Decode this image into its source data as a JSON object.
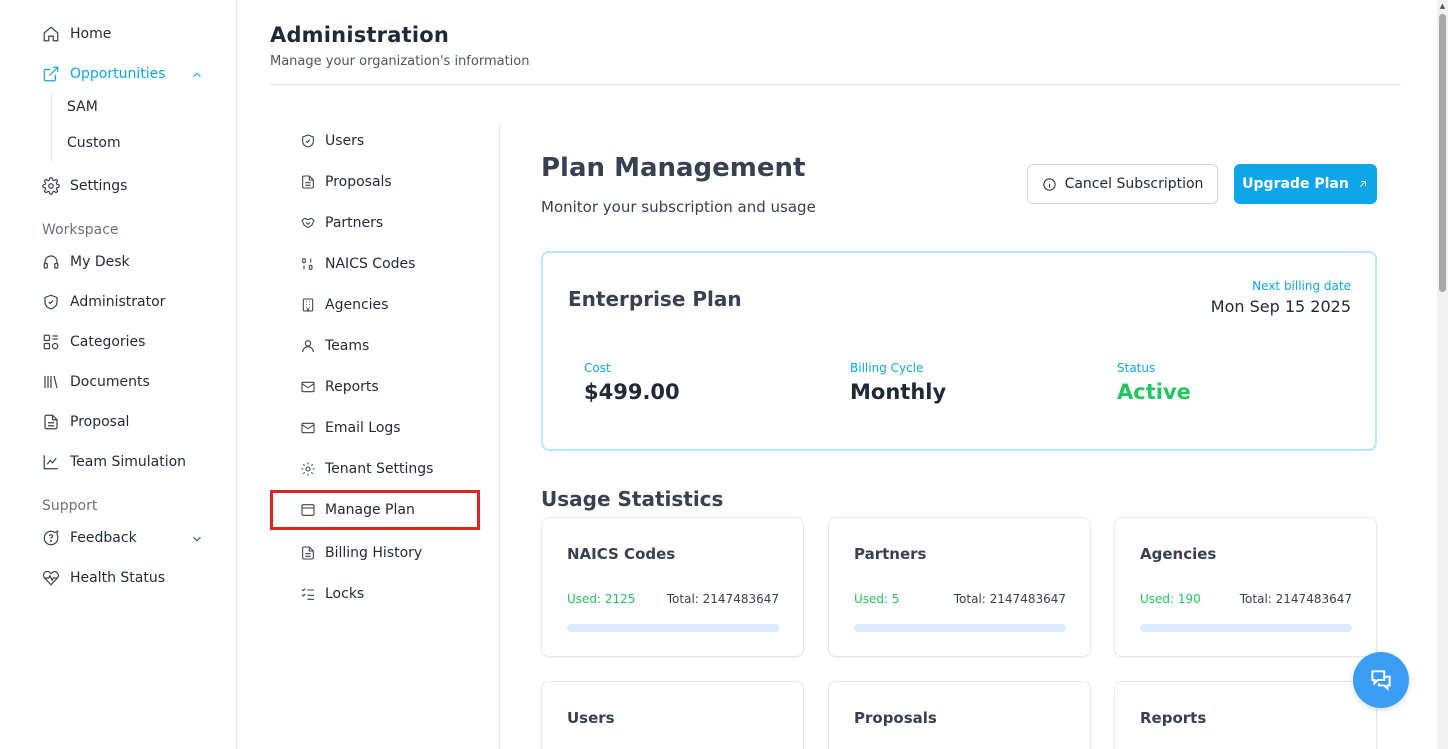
{
  "sidebar": {
    "home": "Home",
    "opportunities": "Opportunities",
    "sam": "SAM",
    "custom": "Custom",
    "settings": "Settings",
    "workspace_label": "Workspace",
    "my_desk": "My Desk",
    "administrator": "Administrator",
    "categories": "Categories",
    "documents": "Documents",
    "proposal": "Proposal",
    "team_simulation": "Team Simulation",
    "support_label": "Support",
    "feedback": "Feedback",
    "health_status": "Health Status"
  },
  "header": {
    "title": "Administration",
    "subtitle": "Manage your organization's information"
  },
  "admin_menu": {
    "users": "Users",
    "proposals": "Proposals",
    "partners": "Partners",
    "naics_codes": "NAICS Codes",
    "agencies": "Agencies",
    "teams": "Teams",
    "reports": "Reports",
    "email_logs": "Email Logs",
    "tenant_settings": "Tenant Settings",
    "manage_plan": "Manage Plan",
    "billing_history": "Billing History",
    "locks": "Locks"
  },
  "main": {
    "title": "Plan Management",
    "subtitle": "Monitor your subscription and usage",
    "cancel_button": "Cancel Subscription",
    "upgrade_button": "Upgrade Plan"
  },
  "plan": {
    "name": "Enterprise Plan",
    "next_billing_label": "Next billing date",
    "next_billing_date": "Mon Sep 15 2025",
    "cost_label": "Cost",
    "cost_value": "$499.00",
    "cycle_label": "Billing Cycle",
    "cycle_value": "Monthly",
    "status_label": "Status",
    "status_value": "Active"
  },
  "usage": {
    "title": "Usage Statistics",
    "cards": [
      {
        "title": "NAICS Codes",
        "used": "Used: 2125",
        "total": "Total: 2147483647",
        "fraction": 1e-06
      },
      {
        "title": "Partners",
        "used": "Used: 5",
        "total": "Total: 2147483647",
        "fraction": 0.0
      },
      {
        "title": "Agencies",
        "used": "Used: 190",
        "total": "Total: 2147483647",
        "fraction": 0.0
      },
      {
        "title": "Users"
      },
      {
        "title": "Proposals"
      },
      {
        "title": "Reports"
      }
    ]
  },
  "colors": {
    "accent": "#0ea5e9",
    "success": "#22c55e",
    "highlight": "#dc2626"
  }
}
